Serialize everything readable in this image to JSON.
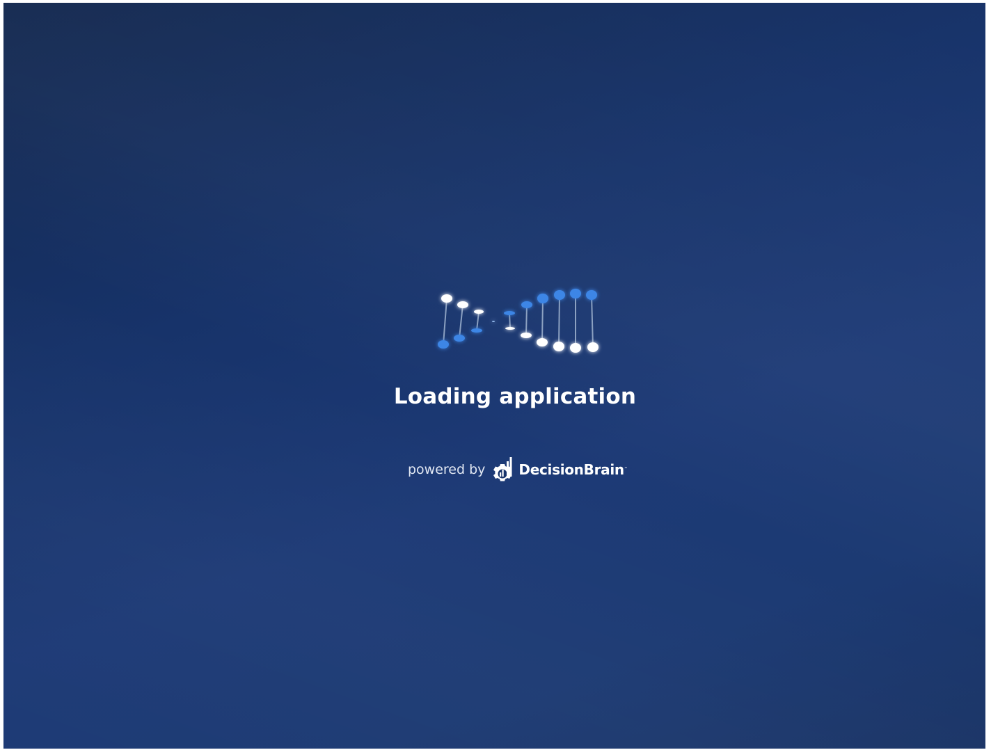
{
  "loading": {
    "title": "Loading application"
  },
  "footer": {
    "powered_label": "powered by",
    "brand_name": "DecisionBrain",
    "brand_tm": "˜",
    "logo_icon": "decisionbrain-gear-chart-icon"
  },
  "spinner": {
    "icon": "dna-helix-loader-icon"
  },
  "colors": {
    "background": "#17336a",
    "accent_blue": "#3d86e6",
    "node_white": "#ffffff"
  }
}
